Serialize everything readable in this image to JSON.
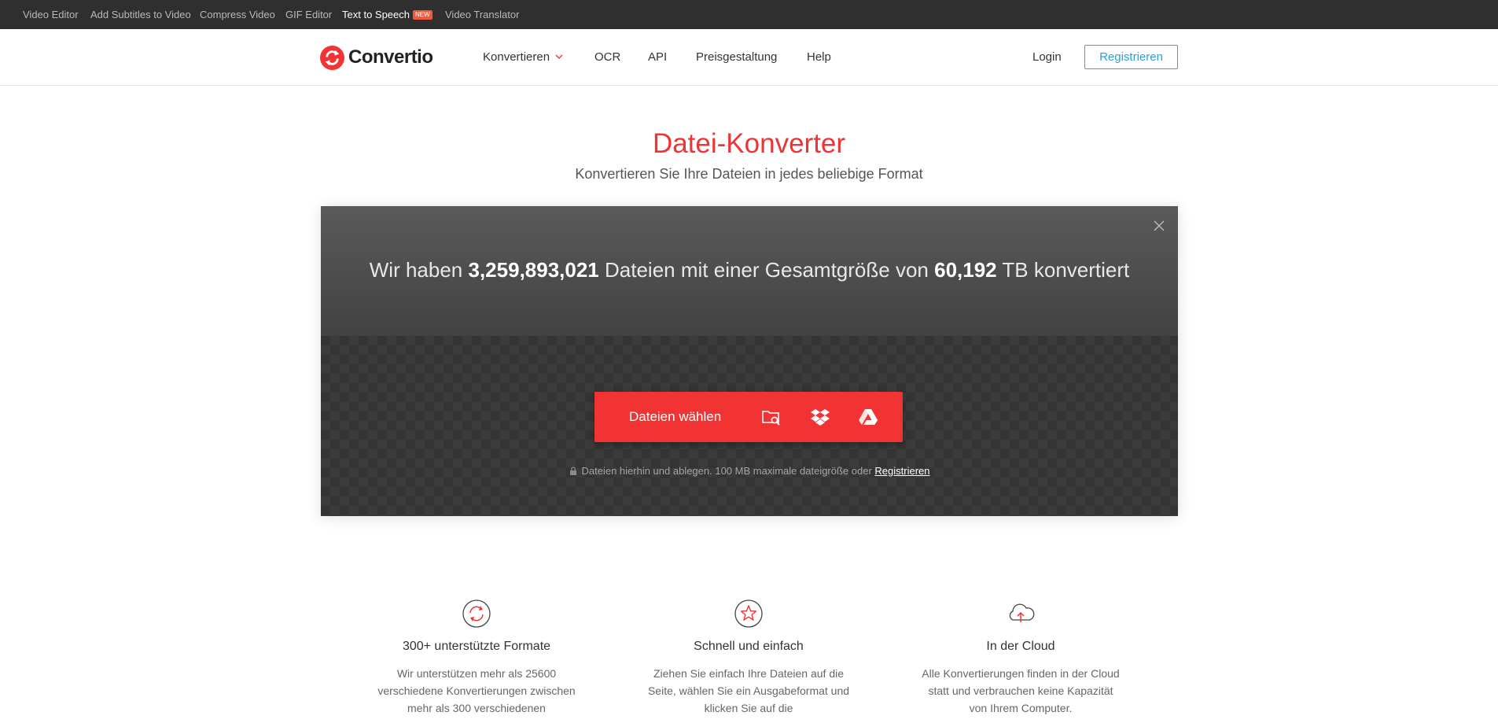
{
  "topbar": {
    "links": [
      {
        "label": "Video Editor"
      },
      {
        "label": "Add Subtitles to Video"
      },
      {
        "label": "Compress Video"
      },
      {
        "label": "GIF Editor"
      },
      {
        "label": "Text to Speech",
        "badge": "NEW"
      },
      {
        "label": "Video Translator"
      }
    ]
  },
  "header": {
    "logo_text": "Convertio",
    "nav": [
      {
        "label": "Konvertieren",
        "icon": "chevron-down-icon"
      },
      {
        "label": "OCR"
      },
      {
        "label": "API"
      },
      {
        "label": "Preisgestaltung"
      },
      {
        "label": "Help"
      }
    ],
    "login_label": "Login",
    "register_label": "Registrieren"
  },
  "hero": {
    "title": "Datei-Konverter",
    "subtitle": "Konvertieren Sie Ihre Dateien in jedes beliebige Format"
  },
  "stats": {
    "prefix": "Wir haben",
    "files_count": "3,259,893,021",
    "middle": "Dateien mit einer Gesamtgröße von",
    "total_size": "60,192",
    "suffix": "TB konvertiert"
  },
  "upload": {
    "choose_label": "Dateien wählen",
    "sources": [
      "folder-search-icon",
      "dropbox-icon",
      "google-drive-icon"
    ],
    "hint": "Dateien hierhin und ablegen. 100 MB maximale dateigröße oder",
    "hint_link": "Registrieren"
  },
  "features": [
    {
      "icon": "refresh-circle-icon",
      "title": "300+ unterstützte Formate",
      "text": "Wir unterstützen mehr als 25600 verschiedene Konvertierungen zwischen mehr als 300 verschiedenen"
    },
    {
      "icon": "star-circle-icon",
      "title": "Schnell und einfach",
      "text": "Ziehen Sie einfach Ihre Dateien auf die Seite, wählen Sie ein Ausgabeformat und klicken Sie auf die"
    },
    {
      "icon": "cloud-upload-icon",
      "title": "In der Cloud",
      "text": "Alle Konvertierungen finden in der Cloud statt und verbrauchen keine Kapazität von Ihrem Computer."
    }
  ],
  "colors": {
    "accent_red": "#f23333",
    "title_red": "#ee3535",
    "register_blue": "#2d9fd6",
    "topbar_bg": "#2f2f2f",
    "new_badge": "#ef5b3a"
  }
}
